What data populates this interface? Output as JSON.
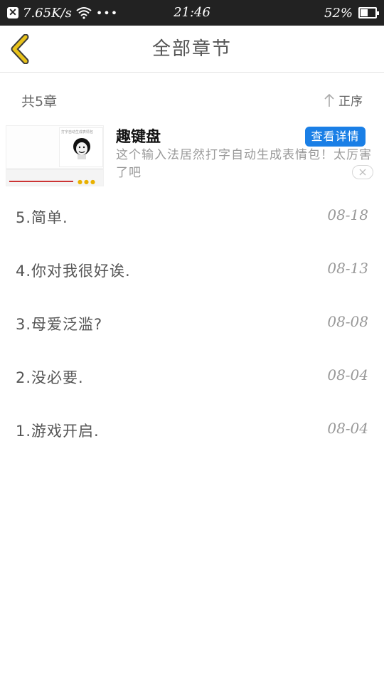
{
  "status_bar": {
    "net_speed": "7.65K/s",
    "dots": "•••",
    "time": "21:46",
    "battery_percent_text": "52%",
    "battery_level": 0.52
  },
  "header": {
    "title": "全部章节",
    "back_icon": "chevron-left-icon",
    "accent_color": "#e8c21a"
  },
  "summary": {
    "count_label": "共5章",
    "sort_label": "正序",
    "sort_icon": "arrow-up-icon"
  },
  "ad": {
    "title": "趣键盘",
    "description": "这个输入法居然打字自动生成表情包！太厉害了吧",
    "cta": "查看详情",
    "thumb_caption": "打字自动生成表情包",
    "cta_color": "#1a7fe6"
  },
  "chapters": [
    {
      "title": "5.简单.",
      "date": "08-18"
    },
    {
      "title": "4.你对我很好诶.",
      "date": "08-13"
    },
    {
      "title": "3.母爱泛滥?",
      "date": "08-08"
    },
    {
      "title": "2.没必要.",
      "date": "08-04"
    },
    {
      "title": "1.游戏开启.",
      "date": "08-04"
    }
  ]
}
